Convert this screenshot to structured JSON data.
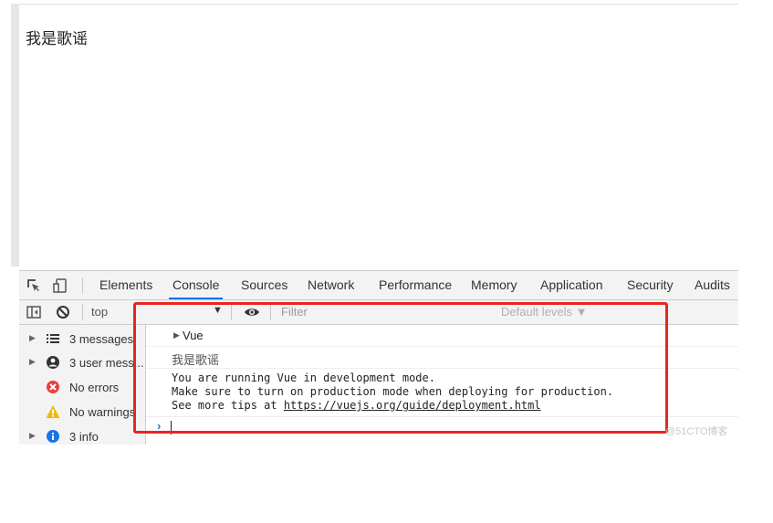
{
  "page": {
    "heading": "我是歌谣"
  },
  "devtools": {
    "tabs": [
      {
        "label": "Elements"
      },
      {
        "label": "Console"
      },
      {
        "label": "Sources"
      },
      {
        "label": "Network"
      },
      {
        "label": "Performance"
      },
      {
        "label": "Memory"
      },
      {
        "label": "Application"
      },
      {
        "label": "Security"
      },
      {
        "label": "Audits"
      }
    ],
    "active_tab": "Console",
    "toolbar": {
      "context": "top",
      "filter_placeholder": "Filter",
      "levels": "Default levels ▼"
    },
    "sidebar": [
      {
        "label": "3 messages",
        "icon": "list-icon"
      },
      {
        "label": "3 user mess...",
        "icon": "user-icon"
      },
      {
        "label": "No errors",
        "icon": "error-icon"
      },
      {
        "label": "No warnings",
        "icon": "warning-icon"
      },
      {
        "label": "3 info",
        "icon": "info-icon"
      }
    ],
    "console": {
      "group_label": "Vue",
      "log_text": "我是歌谣",
      "info_lines": [
        "You are running Vue in development mode.",
        "Make sure to turn on production mode when deploying for production.",
        "See more tips at "
      ],
      "info_link": "https://vuejs.org/guide/deployment.html",
      "prompt": "›"
    }
  },
  "colors": {
    "accent": "#1a73e8",
    "highlight": "#e8261f"
  },
  "watermark": "@51CTO博客"
}
